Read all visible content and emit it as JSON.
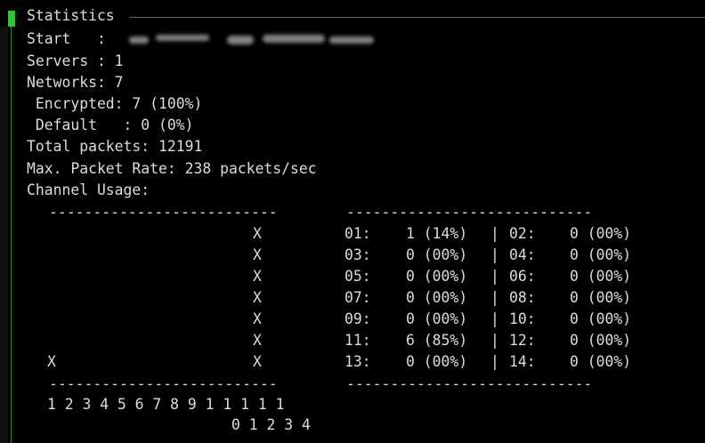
{
  "title": "Statistics",
  "start_label": "Start   :",
  "servers_line": "Servers : 1",
  "networks_line": "Networks: 7",
  "encrypted_line": " Encrypted: 7 (100%)",
  "default_line": " Default   : 0 (0%)",
  "total_packets_line": "Total packets: 12191",
  "max_rate_line": "Max. Packet Rate: 238 packets/sec",
  "channel_usage_line": "Channel Usage:",
  "graph_separator": "--------------------------",
  "table_separator": "----------------------------",
  "graph_x_marks": [
    "X",
    "X",
    "X",
    "X",
    "X",
    "X",
    "X",
    "X"
  ],
  "axis_row1": "1 2 3 4 5 6 7 8 9 1 1 1 1 1",
  "axis_row2": "0 1 2 3 4",
  "channel_rows": [
    {
      "ch_a": "01:",
      "val_a": "1 (14%)",
      "sep": "|",
      "ch_b": "02:",
      "val_b": "0 (00%)"
    },
    {
      "ch_a": "03:",
      "val_a": "0 (00%)",
      "sep": "|",
      "ch_b": "04:",
      "val_b": "0 (00%)"
    },
    {
      "ch_a": "05:",
      "val_a": "0 (00%)",
      "sep": "|",
      "ch_b": "06:",
      "val_b": "0 (00%)"
    },
    {
      "ch_a": "07:",
      "val_a": "0 (00%)",
      "sep": "|",
      "ch_b": "08:",
      "val_b": "0 (00%)"
    },
    {
      "ch_a": "09:",
      "val_a": "0 (00%)",
      "sep": "|",
      "ch_b": "10:",
      "val_b": "0 (00%)"
    },
    {
      "ch_a": "11:",
      "val_a": "6 (85%)",
      "sep": "|",
      "ch_b": "12:",
      "val_b": "0 (00%)"
    },
    {
      "ch_a": "13:",
      "val_a": "0 (00%)",
      "sep": "|",
      "ch_b": "14:",
      "val_b": "0 (00%)"
    }
  ],
  "colors": {
    "background": "#000000",
    "text": "#dcdcdc",
    "border": "#2e8b2e",
    "cursor": "#2ec52e"
  }
}
